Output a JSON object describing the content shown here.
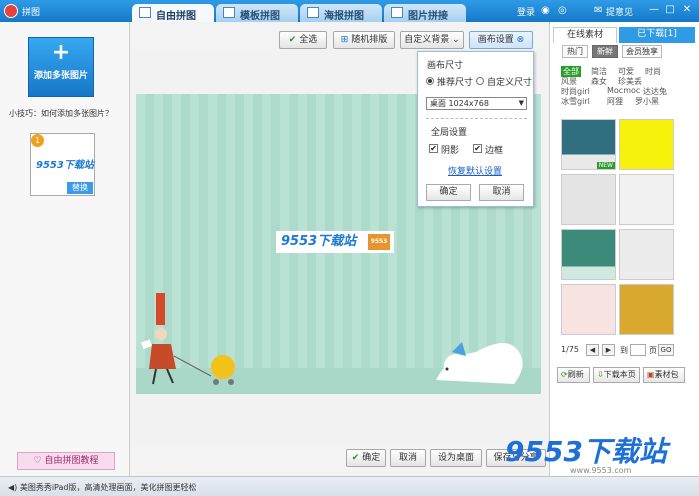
{
  "app": {
    "title": "拼图"
  },
  "tabs": [
    {
      "label": "自由拼图",
      "active": true
    },
    {
      "label": "模板拼图",
      "active": false
    },
    {
      "label": "海报拼图",
      "active": false
    },
    {
      "label": "图片拼接",
      "active": false
    }
  ],
  "top_links": {
    "login": "登录",
    "feedback": "提意见",
    "minimize": "—",
    "maximize": "□",
    "close": "✕"
  },
  "left_panel": {
    "add_plus": "+",
    "add_label": "添加多张图片",
    "tip": "小技巧：如何添加多张图片？",
    "thumb_badge": "1",
    "thumb_logo": "9553下载站",
    "thumb_replace": "替换",
    "tutorial": "自由拼图教程"
  },
  "toolbar": {
    "select_all": "全选",
    "random_layout": "随机排版",
    "custom_bg": "自定义背景",
    "canvas_settings": "画布设置"
  },
  "poster": {
    "logo": "9553下载站",
    "logo_box": "9553"
  },
  "popup": {
    "canvas_size_title": "画布尺寸",
    "recommended": "推荐尺寸",
    "custom_size": "自定义尺寸",
    "size_value": "桌面  1024x768",
    "global_settings": "全局设置",
    "shadow": "阴影",
    "border": "边框",
    "restore_default": "恢复默认设置",
    "confirm": "确定",
    "cancel": "取消"
  },
  "bottom_actions": {
    "confirm": "确定",
    "cancel": "取消",
    "set_desktop": "设为桌面",
    "save_share": "保存与分享"
  },
  "right_panel": {
    "tab_online": "在线素材",
    "tab_downloaded": "已下载[1]",
    "filters": [
      "热门",
      "新鲜",
      "会员独享"
    ],
    "categories": [
      "全部",
      "简洁",
      "可爱",
      "时尚",
      "风景",
      "森女",
      "珍美丢",
      "时尚girl",
      "Mocmoc",
      "达达兔",
      "冰雪girl",
      "阿狸",
      "罗小黑"
    ],
    "page_current": "1/75",
    "goto_label": "到",
    "page_suffix": "页",
    "go": "GO",
    "refresh": "刷新",
    "download_page": "下载本页",
    "material_pack": "素材包",
    "new_badge": "NEW"
  },
  "status": {
    "text": "美图秀秀iPad版，高清处理画面，美化拼图更轻松"
  },
  "watermark": {
    "text": "9553下载站",
    "url": "www.9553.com"
  },
  "colors": {
    "accent": "#1478c8",
    "poster_bg": "#b9e2d4",
    "brand_red": "#e8423f"
  }
}
